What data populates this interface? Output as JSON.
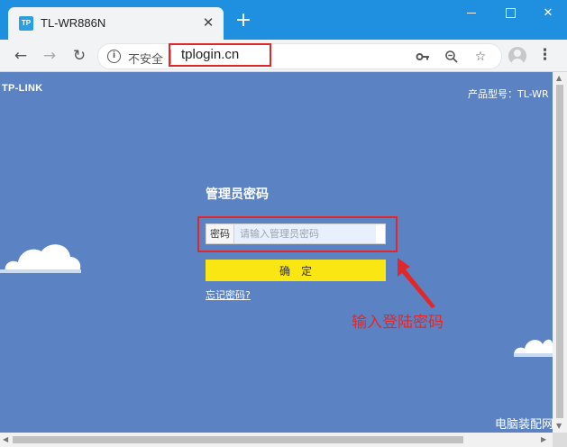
{
  "browser": {
    "tab_title": "TL-WR886N",
    "favicon_text": "TP",
    "security_label": "不安全",
    "url": "tplogin.cn"
  },
  "page": {
    "brand": "TP-LINK",
    "model_label": "产品型号：TL-WR",
    "login_title": "管理员密码",
    "password_label": "密码",
    "password_placeholder": "请输入管理员密码",
    "confirm_label": "确定",
    "forgot_link": "忘记密码?"
  },
  "annotation": {
    "text": "输入登陆密码",
    "color": "#e0282a"
  },
  "watermark": "电脑装配网",
  "colors": {
    "titlebar": "#1f8fe0",
    "page_background": "#5b83c4",
    "confirm_button": "#f9e613",
    "highlight_frame": "#e0282a"
  },
  "icons": [
    "favicon-icon",
    "close-icon",
    "new-tab-icon",
    "minimize-icon",
    "maximize-icon",
    "window-close-icon",
    "back-icon",
    "forward-icon",
    "reload-icon",
    "info-icon",
    "key-icon",
    "zoom-icon",
    "star-icon",
    "avatar-icon",
    "menu-icon",
    "cloud-icon",
    "arrow-icon"
  ]
}
